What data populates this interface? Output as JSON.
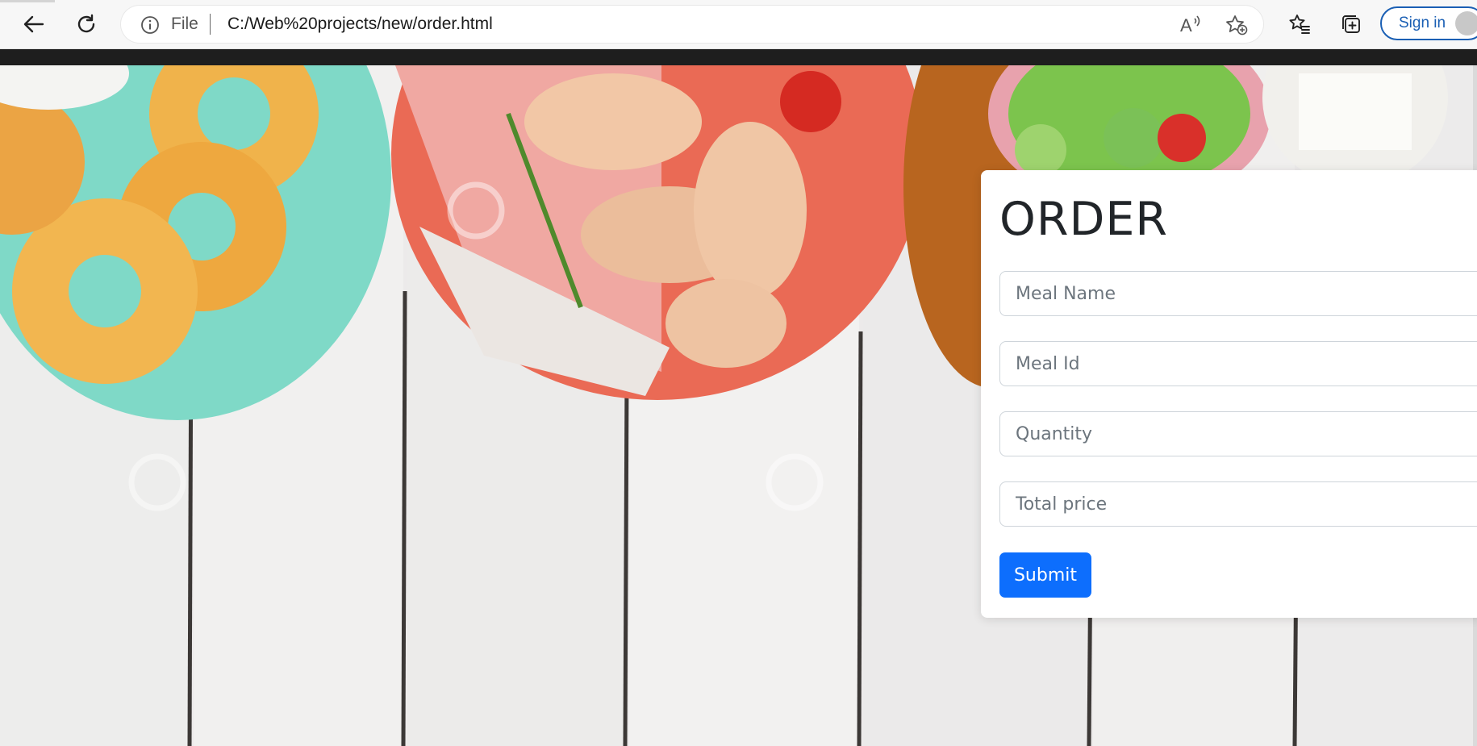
{
  "browser": {
    "file_label": "File",
    "url": "C:/Web%20projects/new/order.html",
    "signin_label": "Sign in",
    "toolbar_icons": [
      "back-arrow-icon",
      "refresh-icon",
      "info-icon",
      "read-aloud-icon",
      "add-favorite-icon",
      "favorites-icon",
      "collections-icon",
      "profile-icon"
    ]
  },
  "order": {
    "title": "ORDER",
    "fields": [
      {
        "placeholder": "Meal Name",
        "value": ""
      },
      {
        "placeholder": "Meal Id",
        "value": ""
      },
      {
        "placeholder": "Quantity",
        "value": ""
      },
      {
        "placeholder": "Total price",
        "value": ""
      }
    ],
    "submit_label": "Submit",
    "accent": "#0d6efd"
  }
}
